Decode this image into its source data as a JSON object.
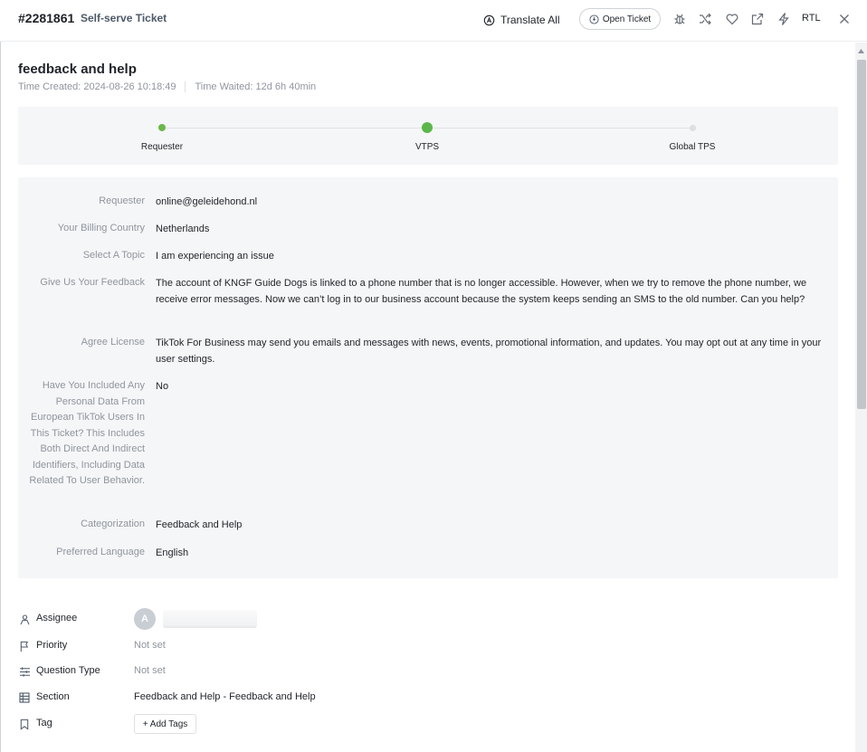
{
  "header": {
    "ticket_id": "#2281861",
    "ticket_type": "Self-serve Ticket",
    "translate_all": "Translate All",
    "open_ticket": "Open Ticket",
    "rtl": "RTL"
  },
  "ticket": {
    "title": "feedback and help",
    "time_created": "Time Created: 2024-08-26 10:18:49",
    "time_waited": "Time Waited: 12d 6h 40min"
  },
  "progress": {
    "steps": [
      {
        "label": "Requester",
        "state": "done"
      },
      {
        "label": "VTPS",
        "state": "current"
      },
      {
        "label": "Global TPS",
        "state": "pending"
      }
    ],
    "colors": {
      "done": "#6ab84a",
      "current": "#5cb74a",
      "pending": "#dcdfe3"
    }
  },
  "fields": [
    {
      "label": "Requester",
      "value": "online@geleidehond.nl"
    },
    {
      "label": "Your Billing Country",
      "value": "Netherlands"
    },
    {
      "label": "Select A Topic",
      "value": "I am experiencing an issue"
    },
    {
      "label": "Give Us Your Feedback",
      "value": "The account of KNGF Guide Dogs is linked to a phone number that is no longer accessible. However, when we try to remove the phone number, we receive error messages. Now we can’t log in to our business account because the system keeps sending an SMS to the old number. Can you help?"
    },
    {
      "label": "Agree License",
      "value": "TikTok For Business may send you emails and messages with news, events, promotional information, and updates. You may opt out at any time in your user settings."
    },
    {
      "label": "Have You Included Any Personal Data From European TikTok Users In This Ticket? This Includes Both Direct And Indirect Identifiers, Including Data Related To User Behavior.",
      "value": "No"
    },
    {
      "label": "Categorization",
      "value": "Feedback and Help"
    },
    {
      "label": "Preferred Language",
      "value": "English"
    }
  ],
  "properties": {
    "assignee": {
      "label": "Assignee",
      "avatar": "A"
    },
    "priority": {
      "label": "Priority",
      "value": "Not set"
    },
    "question_type": {
      "label": "Question Type",
      "value": "Not set"
    },
    "section": {
      "label": "Section",
      "value": "Feedback and Help - Feedback and Help"
    },
    "tag": {
      "label": "Tag",
      "button": "+ Add Tags"
    }
  },
  "icons": [
    "translate-icon",
    "open-ticket-icon",
    "bug-icon",
    "shuffle-icon",
    "heart-icon",
    "external-link-icon",
    "lightning-icon",
    "close-icon",
    "person-icon",
    "flag-icon",
    "sliders-icon",
    "grid-icon",
    "bookmark-icon"
  ]
}
